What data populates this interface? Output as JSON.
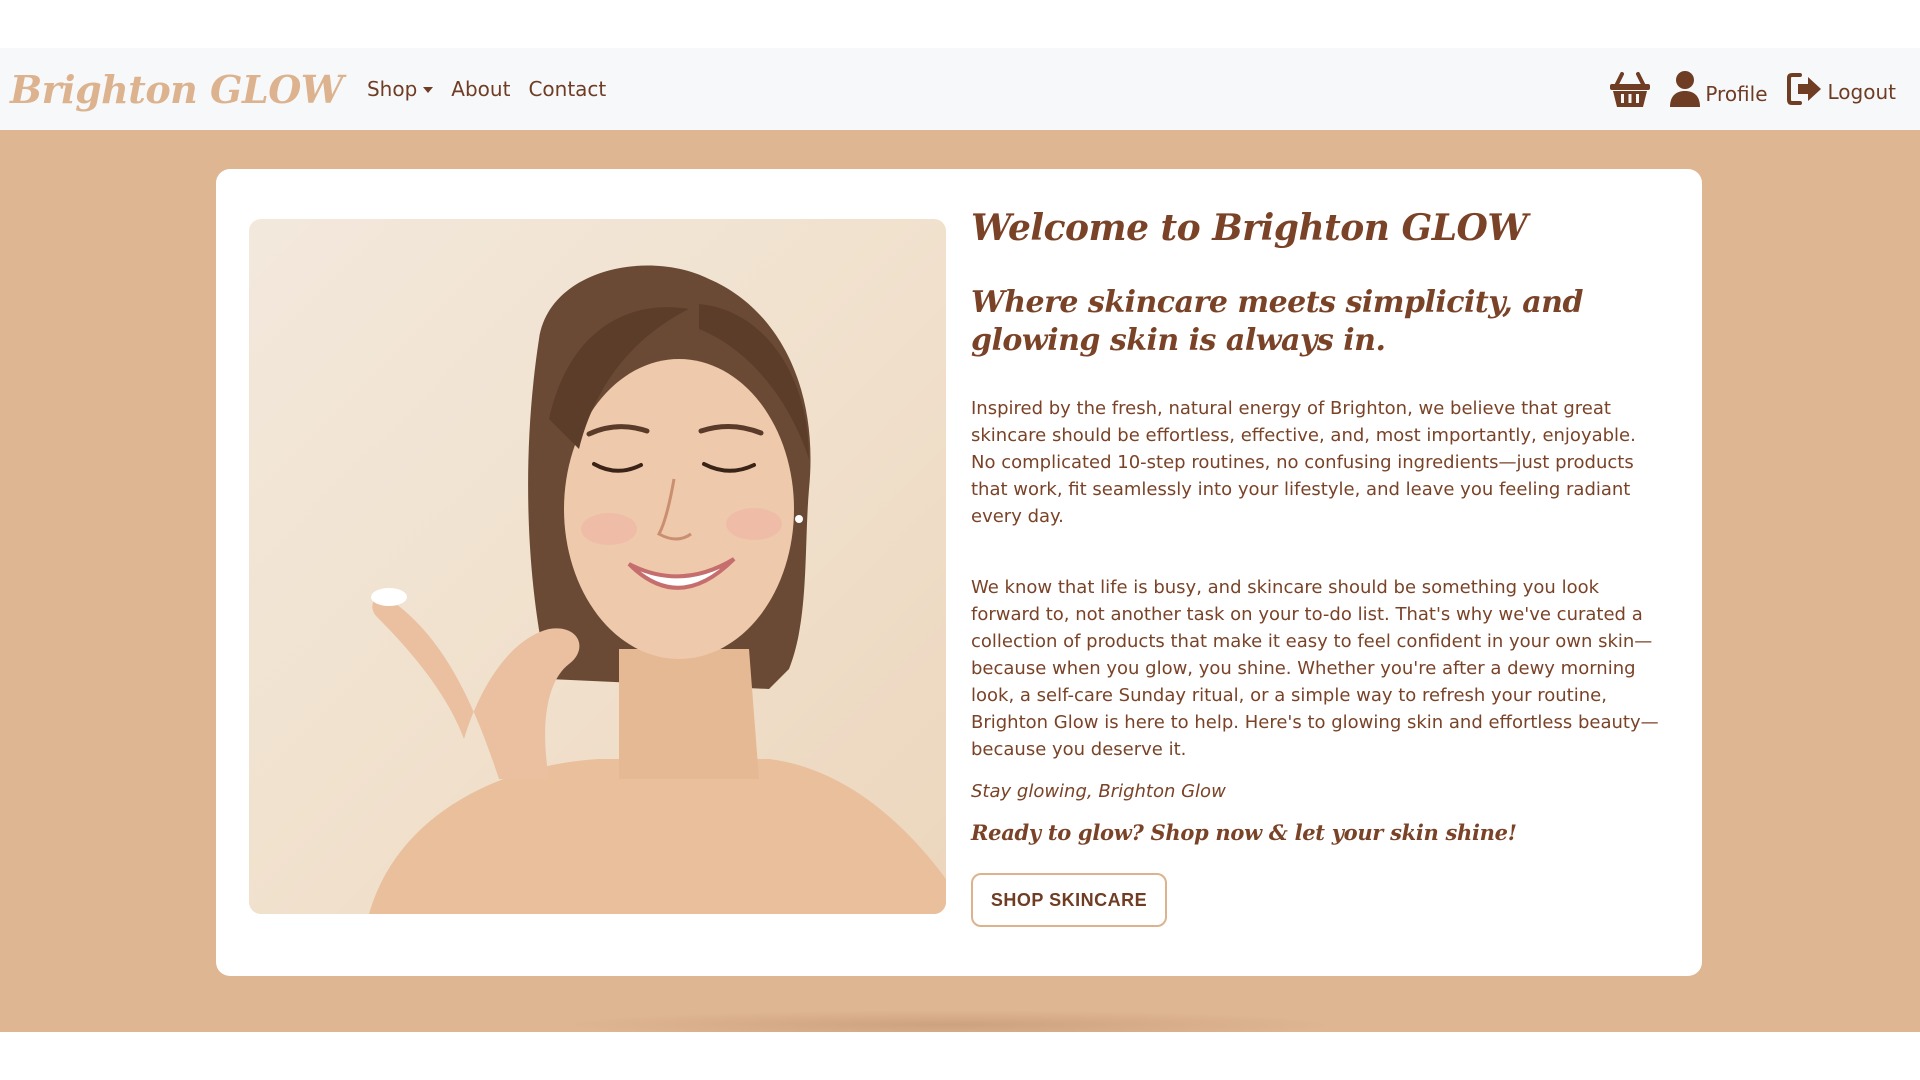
{
  "navbar": {
    "brand": "Brighton GLOW",
    "links": [
      {
        "label": "Shop",
        "has_dropdown": true
      },
      {
        "label": "About"
      },
      {
        "label": "Contact"
      }
    ],
    "cart_icon": "basket-icon",
    "profile": {
      "icon": "user-icon",
      "label": "Profile"
    },
    "logout": {
      "icon": "logout-icon",
      "label": "Logout"
    }
  },
  "hero": {
    "image_alt": "Smiling woman applying skincare cream",
    "title": "Welcome to Brighton GLOW",
    "tagline": "Where skincare meets simplicity, and glowing skin is always in.",
    "paragraph1": "Inspired by the fresh, natural energy of Brighton, we believe that great skincare should be effortless, effective, and, most importantly, enjoyable. No complicated 10-step routines, no confusing ingredients—just products that work, fit seamlessly into your lifestyle, and leave you feeling radiant every day.",
    "paragraph2": "We know that life is busy, and skincare should be something you look forward to, not another task on your to-do list. That's why we've curated a collection of products that make it easy to feel confident in your own skin—because when you glow, you shine. Whether you're after a dewy morning look, a self-care Sunday ritual, or a simple way to refresh your routine, Brighton Glow is here to help. Here's to glowing skin and effortless beauty—because you deserve it.",
    "signoff": "Stay glowing, Brighton Glow",
    "cta_text": "Ready to glow? Shop now & let your skin shine!",
    "button_label": "SHOP SKINCARE"
  },
  "colors": {
    "brand_tan": "#dcb38e",
    "hero_background": "#dfb692",
    "text_brown": "#7a4328",
    "navbar_background": "#f7f8fa"
  }
}
